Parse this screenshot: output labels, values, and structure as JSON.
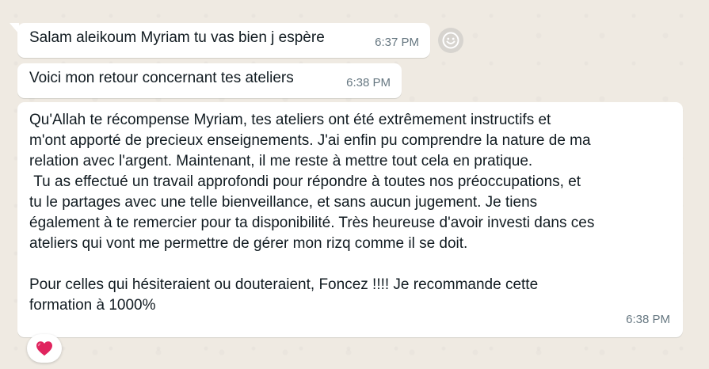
{
  "messages": [
    {
      "text": "Salam aleikoum Myriam tu vas bien j espère",
      "time": "6:37 PM"
    },
    {
      "text": "Voici mon retour concernant tes ateliers",
      "time": "6:38 PM"
    },
    {
      "text": "Qu'Allah te récompense Myriam, tes ateliers ont été extrêmement instructifs et\nm'ont apporté de precieux enseignements. J'ai enfin pu comprendre la nature de ma\nrelation avec l'argent. Maintenant, il me reste à mettre tout cela en pratique.\n Tu as effectué un travail approfondi pour répondre à toutes nos préoccupations, et\ntu le partages avec une telle bienveillance, et sans aucun jugement. Je tiens\négalement à te remercier pour ta disponibilité. Très heureuse d'avoir investi dans ces\nateliers qui vont me permettre de gérer mon rizq comme il se doit.\n\nPour celles qui hésiteraient ou douteraient, Foncez !!!! Je recommande cette\nformation à 1000%",
      "time": "6:38 PM"
    }
  ],
  "reaction": {
    "emoji": "heart-icon",
    "color": "#e0245e"
  },
  "colors": {
    "background": "#efeae2",
    "bubble": "#ffffff",
    "text": "#111b21",
    "timestamp": "#667781"
  }
}
